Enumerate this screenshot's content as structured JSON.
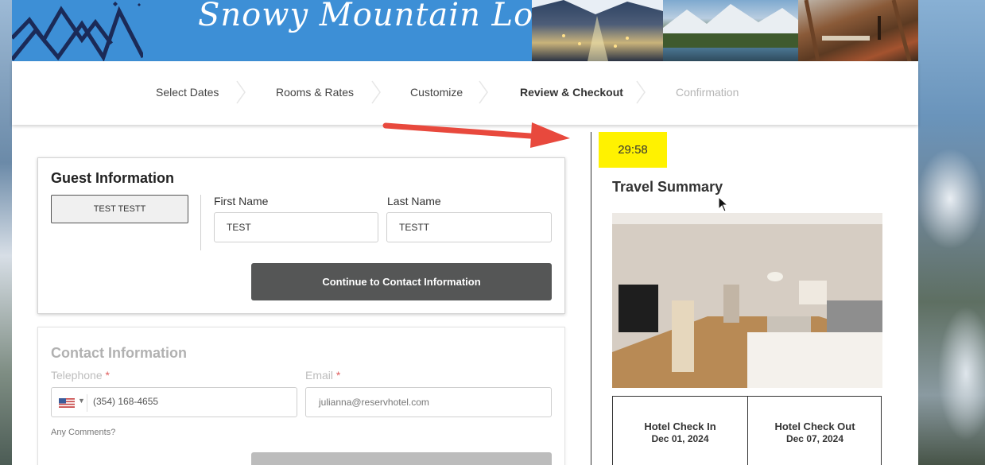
{
  "header": {
    "logo_text": "Snowy Mountain Lodge"
  },
  "steps": [
    {
      "label": "Select Dates",
      "state": "done"
    },
    {
      "label": "Rooms & Rates",
      "state": "done"
    },
    {
      "label": "Customize",
      "state": "done"
    },
    {
      "label": "Review & Checkout",
      "state": "active"
    },
    {
      "label": "Confirmation",
      "state": "disabled"
    }
  ],
  "timer": {
    "value": "29:58",
    "color": "#fff200"
  },
  "guest_info": {
    "title": "Guest Information",
    "guest_pill": "TEST TESTT",
    "first_name_label": "First Name",
    "first_name_value": "TEST",
    "last_name_label": "Last Name",
    "last_name_value": "TESTT",
    "continue_button": "Continue to Contact Information"
  },
  "contact_info": {
    "title": "Contact Information",
    "telephone_label": "Telephone",
    "telephone_value": "(354) 168-4655",
    "email_label": "Email",
    "email_value": "julianna@reservhotel.com",
    "required_mark": "*",
    "comments_label": "Any Comments?"
  },
  "travel_summary": {
    "title": "Travel Summary",
    "check_in_label": "Hotel Check In",
    "check_in_date": "Dec 01, 2024",
    "check_out_label": "Hotel Check Out",
    "check_out_date": "Dec 07, 2024"
  },
  "colors": {
    "header_blue": "#3d8fd6",
    "button_dark": "#555656",
    "annotation_arrow": "#e8493d"
  }
}
